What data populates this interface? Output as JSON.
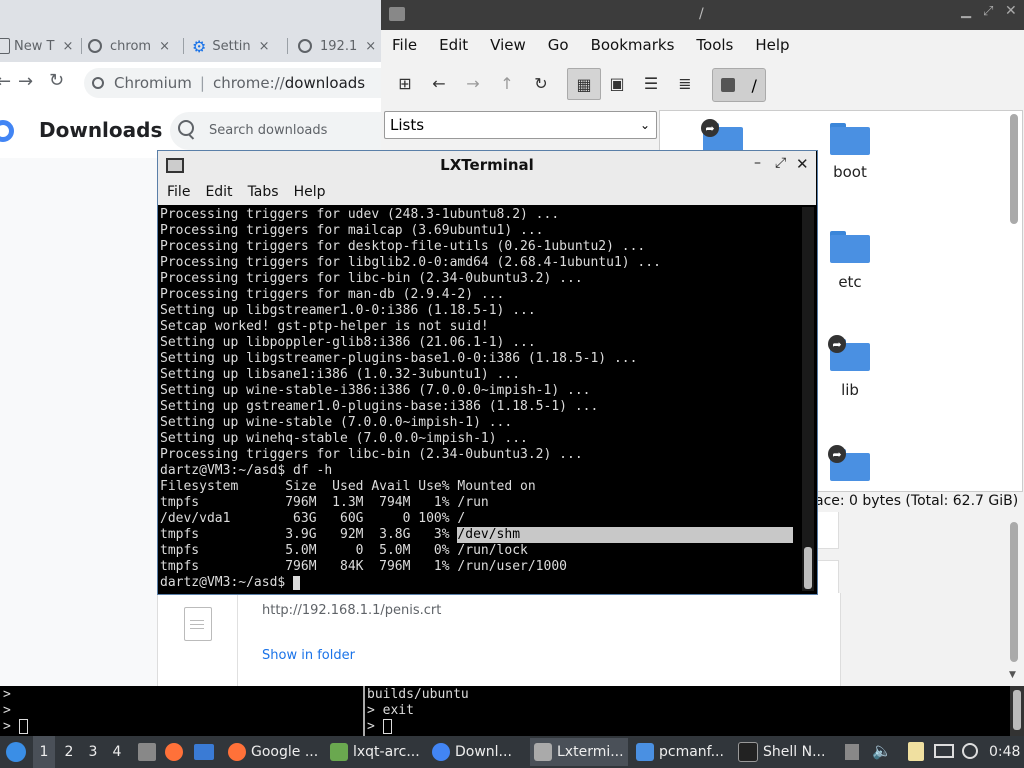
{
  "chromium": {
    "tabs": [
      {
        "label": "New T",
        "icon": "new-tab-icon"
      },
      {
        "label": "chrom",
        "icon": "globe-icon"
      },
      {
        "label": "Settin",
        "icon": "settings-gear-icon"
      },
      {
        "label": "192.1",
        "icon": "globe-icon"
      }
    ],
    "tab_close": "×",
    "omnibox_site": "Chromium",
    "omnibox_sep": "|",
    "omnibox_url_prefix": "chrome://",
    "omnibox_url_bold": "downloads",
    "page_title": "Downloads",
    "search_placeholder": "Search downloads",
    "download": {
      "url": "http://192.168.1.1/penis.crt",
      "show_in_folder": "Show in folder"
    }
  },
  "file_manager": {
    "title": "/",
    "menu": [
      "File",
      "Edit",
      "View",
      "Go",
      "Bookmarks",
      "Tools",
      "Help"
    ],
    "path": "/",
    "view_mode": "Lists",
    "folders": [
      {
        "label": "",
        "symlink": true
      },
      {
        "label": "boot",
        "symlink": false
      },
      {
        "label": "etc",
        "symlink": false
      },
      {
        "label": "lib",
        "symlink": true
      },
      {
        "label": "",
        "symlink": true
      }
    ],
    "status": "ace: 0 bytes (Total: 62.7 GiB)"
  },
  "terminal": {
    "title": "LXTerminal",
    "menu": [
      "File",
      "Edit",
      "Tabs",
      "Help"
    ],
    "lines": [
      "Processing triggers for udev (248.3-1ubuntu8.2) ...",
      "Processing triggers for mailcap (3.69ubuntu1) ...",
      "Processing triggers for desktop-file-utils (0.26-1ubuntu2) ...",
      "Processing triggers for libglib2.0-0:amd64 (2.68.4-1ubuntu1) ...",
      "Processing triggers for libc-bin (2.34-0ubuntu3.2) ...",
      "Processing triggers for man-db (2.9.4-2) ...",
      "Setting up libgstreamer1.0-0:i386 (1.18.5-1) ...",
      "Setcap worked! gst-ptp-helper is not suid!",
      "Setting up libpoppler-glib8:i386 (21.06.1-1) ...",
      "Setting up libgstreamer-plugins-base1.0-0:i386 (1.18.5-1) ...",
      "Setting up libsane1:i386 (1.0.32-3ubuntu1) ...",
      "Setting up wine-stable-i386:i386 (7.0.0.0~impish-1) ...",
      "Setting up gstreamer1.0-plugins-base:i386 (1.18.5-1) ...",
      "Setting up wine-stable (7.0.0.0~impish-1) ...",
      "Setting up winehq-stable (7.0.0.0~impish-1) ...",
      "Processing triggers for libc-bin (2.34-0ubuntu3.2) ...",
      "dartz@VM3:~/asd$ df -h",
      "Filesystem      Size  Used Avail Use% Mounted on",
      "tmpfs           796M  1.3M  794M   1% /run",
      "/dev/vda1        63G   60G     0 100% /"
    ],
    "hl_line_prefix": "tmpfs           3.9G   92M  3.8G   3% ",
    "hl_line_mount": "/dev/shm",
    "lines_after": [
      "tmpfs           5.0M     0  5.0M   0% /run/lock",
      "tmpfs           796M   84K  796M   1% /run/user/1000"
    ],
    "prompt": "dartz@VM3:~/asd$ "
  },
  "bottom_terminal": {
    "left": ">\n>\n> ",
    "right": "builds/ubuntu\n> exit\n> "
  },
  "taskbar": {
    "desktops": [
      "1",
      "2",
      "3",
      "4"
    ],
    "tasks": [
      {
        "label": "Google ...",
        "icon": "firefox-icon"
      },
      {
        "label": "lxqt-arc...",
        "icon": "archive-icon"
      },
      {
        "label": "Downl...",
        "icon": "chromium-icon"
      },
      {
        "label": "Lxtermi...",
        "icon": "terminal-icon"
      },
      {
        "label": "pcmanf...",
        "icon": "folder-icon"
      },
      {
        "label": "Shell N...",
        "icon": "shell-icon"
      }
    ],
    "clock": "0:48"
  },
  "colors": {
    "folder": "#4a90e2",
    "taskbar": "#31363b",
    "link": "#1a73e8"
  }
}
